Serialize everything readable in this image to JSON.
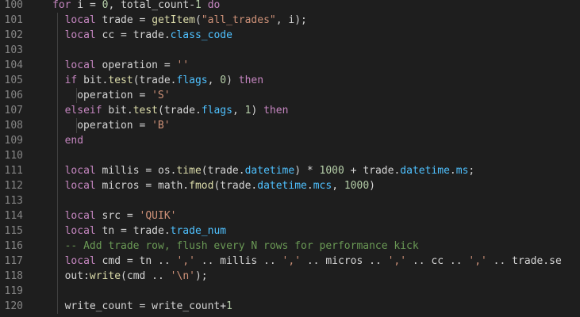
{
  "editor": {
    "colors": {
      "background": "#1e1e1e",
      "text": "#d4d4d4",
      "line_number": "#858585",
      "keyword": "#c586c0",
      "function": "#dcdcaa",
      "string": "#ce9178",
      "number": "#b5cea8",
      "property": "#4fc1ff",
      "comment": "#6a9955"
    },
    "lines": [
      {
        "n": "100",
        "indent": 0,
        "tokens": [
          {
            "t": "for",
            "c": "kw"
          },
          {
            "t": " i = ",
            "c": "var"
          },
          {
            "t": "0",
            "c": "num"
          },
          {
            "t": ", total_count-",
            "c": "var"
          },
          {
            "t": "1",
            "c": "num"
          },
          {
            "t": " ",
            "c": "var"
          },
          {
            "t": "do",
            "c": "kw"
          }
        ]
      },
      {
        "n": "101",
        "indent": 1,
        "tokens": [
          {
            "t": "local",
            "c": "kw"
          },
          {
            "t": " trade = ",
            "c": "var"
          },
          {
            "t": "getItem",
            "c": "fn"
          },
          {
            "t": "(",
            "c": "var"
          },
          {
            "t": "\"all_trades\"",
            "c": "str"
          },
          {
            "t": ", i);",
            "c": "var"
          }
        ]
      },
      {
        "n": "102",
        "indent": 1,
        "tokens": [
          {
            "t": "local",
            "c": "kw"
          },
          {
            "t": " cc = trade.",
            "c": "var"
          },
          {
            "t": "class_code",
            "c": "prop"
          }
        ]
      },
      {
        "n": "103",
        "indent": 1,
        "tokens": []
      },
      {
        "n": "104",
        "indent": 1,
        "tokens": [
          {
            "t": "local",
            "c": "kw"
          },
          {
            "t": " operation = ",
            "c": "var"
          },
          {
            "t": "''",
            "c": "str"
          }
        ]
      },
      {
        "n": "105",
        "indent": 1,
        "tokens": [
          {
            "t": "if",
            "c": "kw"
          },
          {
            "t": " bit.",
            "c": "var"
          },
          {
            "t": "test",
            "c": "fn"
          },
          {
            "t": "(trade.",
            "c": "var"
          },
          {
            "t": "flags",
            "c": "prop"
          },
          {
            "t": ", ",
            "c": "var"
          },
          {
            "t": "0",
            "c": "num"
          },
          {
            "t": ") ",
            "c": "var"
          },
          {
            "t": "then",
            "c": "kw"
          }
        ]
      },
      {
        "n": "106",
        "indent": 2,
        "tokens": [
          {
            "t": "operation = ",
            "c": "var"
          },
          {
            "t": "'S'",
            "c": "str"
          }
        ]
      },
      {
        "n": "107",
        "indent": 1,
        "tokens": [
          {
            "t": "elseif",
            "c": "kw"
          },
          {
            "t": " bit.",
            "c": "var"
          },
          {
            "t": "test",
            "c": "fn"
          },
          {
            "t": "(trade.",
            "c": "var"
          },
          {
            "t": "flags",
            "c": "prop"
          },
          {
            "t": ", ",
            "c": "var"
          },
          {
            "t": "1",
            "c": "num"
          },
          {
            "t": ") ",
            "c": "var"
          },
          {
            "t": "then",
            "c": "kw"
          }
        ]
      },
      {
        "n": "108",
        "indent": 2,
        "tokens": [
          {
            "t": "operation = ",
            "c": "var"
          },
          {
            "t": "'B'",
            "c": "str"
          }
        ]
      },
      {
        "n": "109",
        "indent": 1,
        "tokens": [
          {
            "t": "end",
            "c": "kw"
          }
        ]
      },
      {
        "n": "110",
        "indent": 1,
        "tokens": []
      },
      {
        "n": "111",
        "indent": 1,
        "tokens": [
          {
            "t": "local",
            "c": "kw"
          },
          {
            "t": " millis = os.",
            "c": "var"
          },
          {
            "t": "time",
            "c": "fn"
          },
          {
            "t": "(trade.",
            "c": "var"
          },
          {
            "t": "datetime",
            "c": "prop"
          },
          {
            "t": ") * ",
            "c": "var"
          },
          {
            "t": "1000",
            "c": "num"
          },
          {
            "t": " + trade.",
            "c": "var"
          },
          {
            "t": "datetime",
            "c": "prop"
          },
          {
            "t": ".",
            "c": "var"
          },
          {
            "t": "ms",
            "c": "prop"
          },
          {
            "t": ";",
            "c": "var"
          }
        ]
      },
      {
        "n": "112",
        "indent": 1,
        "tokens": [
          {
            "t": "local",
            "c": "kw"
          },
          {
            "t": " micros = math.",
            "c": "var"
          },
          {
            "t": "fmod",
            "c": "fn"
          },
          {
            "t": "(trade.",
            "c": "var"
          },
          {
            "t": "datetime",
            "c": "prop"
          },
          {
            "t": ".",
            "c": "var"
          },
          {
            "t": "mcs",
            "c": "prop"
          },
          {
            "t": ", ",
            "c": "var"
          },
          {
            "t": "1000",
            "c": "num"
          },
          {
            "t": ")",
            "c": "var"
          }
        ]
      },
      {
        "n": "113",
        "indent": 1,
        "tokens": []
      },
      {
        "n": "114",
        "indent": 1,
        "tokens": [
          {
            "t": "local",
            "c": "kw"
          },
          {
            "t": " src = ",
            "c": "var"
          },
          {
            "t": "'QUIK'",
            "c": "str"
          }
        ]
      },
      {
        "n": "115",
        "indent": 1,
        "tokens": [
          {
            "t": "local",
            "c": "kw"
          },
          {
            "t": " tn = trade.",
            "c": "var"
          },
          {
            "t": "trade_num",
            "c": "prop"
          }
        ]
      },
      {
        "n": "116",
        "indent": 1,
        "tokens": [
          {
            "t": "-- Add trade row, flush every N rows for performance kick",
            "c": "com"
          }
        ]
      },
      {
        "n": "117",
        "indent": 1,
        "tokens": [
          {
            "t": "local",
            "c": "kw"
          },
          {
            "t": " cmd = tn .. ",
            "c": "var"
          },
          {
            "t": "','",
            "c": "str"
          },
          {
            "t": " .. millis .. ",
            "c": "var"
          },
          {
            "t": "','",
            "c": "str"
          },
          {
            "t": " .. micros .. ",
            "c": "var"
          },
          {
            "t": "','",
            "c": "str"
          },
          {
            "t": " .. cc .. ",
            "c": "var"
          },
          {
            "t": "','",
            "c": "str"
          },
          {
            "t": " .. trade.se",
            "c": "var"
          }
        ]
      },
      {
        "n": "118",
        "indent": 1,
        "tokens": [
          {
            "t": "out:",
            "c": "var"
          },
          {
            "t": "write",
            "c": "fn"
          },
          {
            "t": "(cmd .. ",
            "c": "var"
          },
          {
            "t": "'\\n'",
            "c": "str"
          },
          {
            "t": ");",
            "c": "var"
          }
        ]
      },
      {
        "n": "119",
        "indent": 1,
        "tokens": []
      },
      {
        "n": "120",
        "indent": 1,
        "tokens": [
          {
            "t": "write_count = write_count+",
            "c": "var"
          },
          {
            "t": "1",
            "c": "num"
          }
        ]
      }
    ]
  }
}
